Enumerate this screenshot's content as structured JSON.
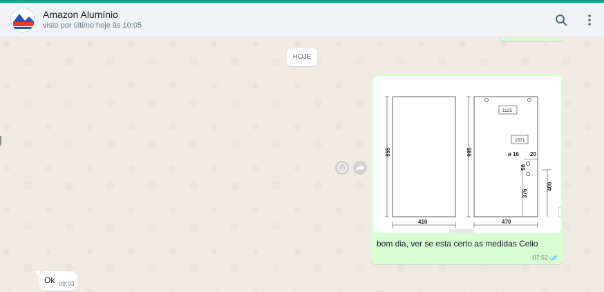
{
  "header": {
    "contact_name": "Amazon Alumínio",
    "status": "visto por último hoje às 10:05",
    "avatar_text": "AMAZON ALUMÍNIO"
  },
  "chat": {
    "date_chip": "HOJE",
    "outgoing": {
      "caption": "bom dia, ver se esta certo as medidas Celio",
      "time": "07:52",
      "drawing": {
        "panel_a": {
          "height_label": "955",
          "width_label": "410"
        },
        "panel_b": {
          "height_label": "995",
          "width_label": "470",
          "box_top": "1125",
          "box_mid": "1571",
          "diameter_label": "ø 16",
          "offset_label": "20",
          "hole_spacing": "50",
          "hole_height": "375",
          "side_height": "400"
        }
      }
    },
    "incoming": {
      "text": "Ok",
      "time": "09:03"
    }
  },
  "colors": {
    "accent": "#00a884",
    "outgoing_bubble": "#d9fdd3",
    "read_ticks": "#53bdeb"
  },
  "icons": {
    "search": "search-icon",
    "menu": "menu-dots-icon",
    "reaction": "emoji-icon",
    "forward": "forward-icon",
    "ticks": "double-check-icon"
  }
}
